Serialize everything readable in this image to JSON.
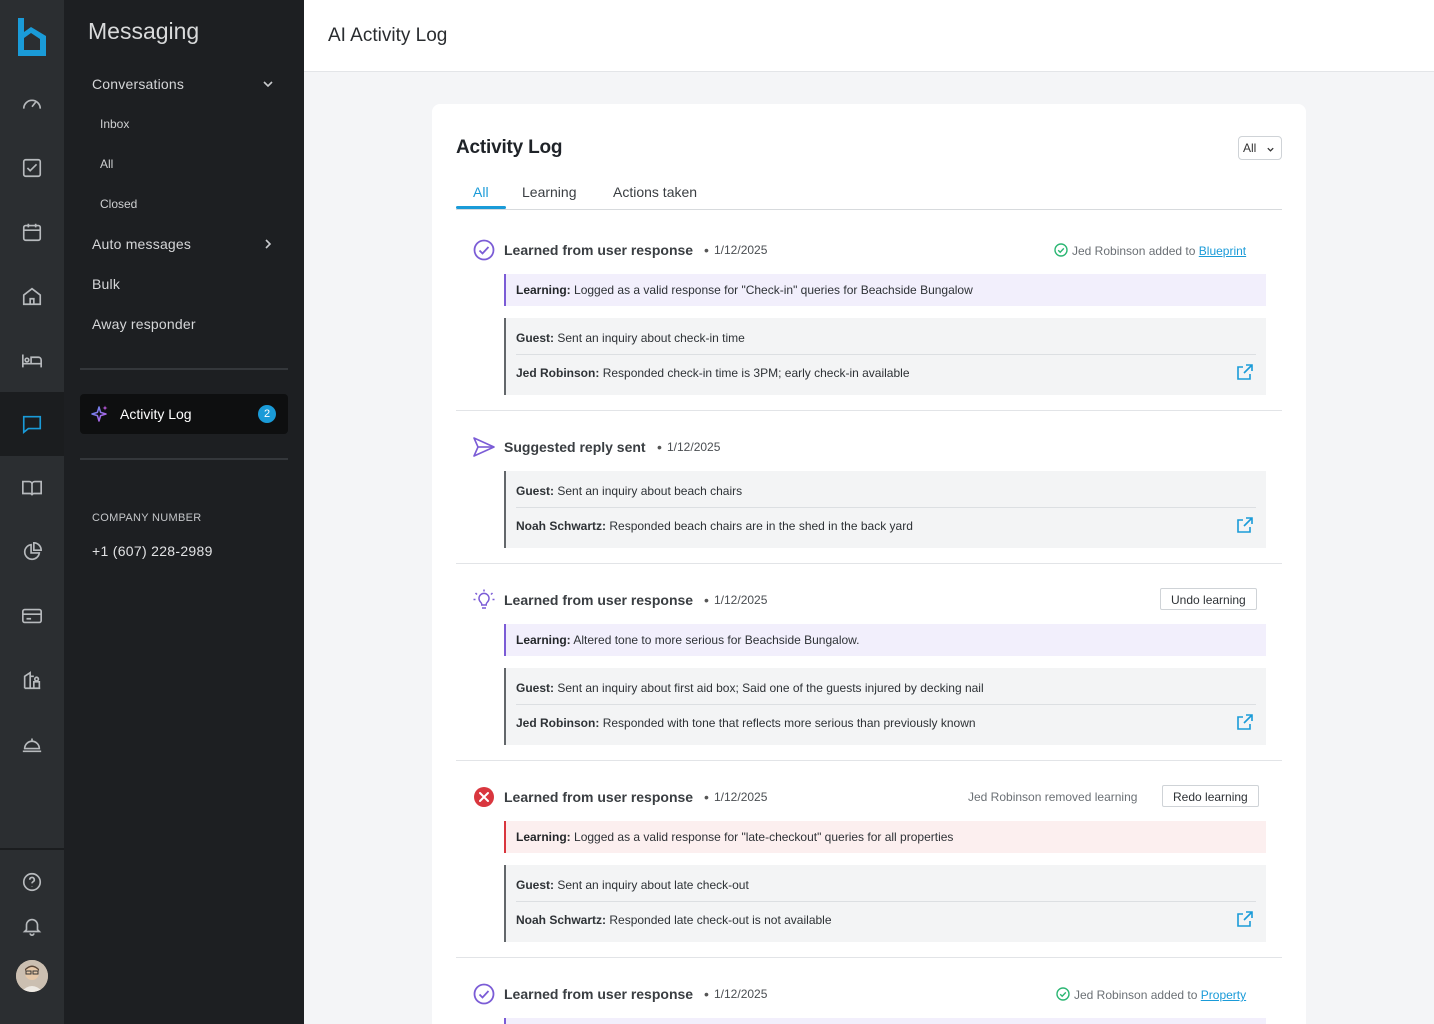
{
  "rail": {
    "items": [
      "dashboard-icon",
      "tasks-icon",
      "calendar-icon",
      "home-icon",
      "bed-icon",
      "messaging-icon",
      "guidebook-icon",
      "reports-icon",
      "billing-icon",
      "owners-icon",
      "concierge-icon"
    ],
    "bottom": [
      "help-icon",
      "notifications-icon",
      "avatar"
    ],
    "accent": "#1a9bd8"
  },
  "sidebar": {
    "title": "Messaging",
    "conversations": "Conversations",
    "inbox": "Inbox",
    "all": "All",
    "closed": "Closed",
    "auto_messages": "Auto messages",
    "bulk": "Bulk",
    "away_responder": "Away responder",
    "activity_log": "Activity Log",
    "activity_badge": "2",
    "company_label": "COMPANY NUMBER",
    "company_number": "+1 (607) 228-2989"
  },
  "header": {
    "title": "AI Activity Log"
  },
  "card": {
    "title": "Activity Log",
    "filter": "All",
    "tabs": [
      "All",
      "Learning",
      "Actions taken"
    ]
  },
  "entries": [
    {
      "title": "Learned from user response",
      "dot": "•",
      "date": "1/12/2025",
      "meta_text": "Jed Robinson added to",
      "meta_link": "Blueprint",
      "learning_label": "Learning:",
      "learning_text": "Logged as a valid response for \"Check-in\" queries for Beachside Bungalow",
      "guest_label": "Guest:",
      "guest_text": "Sent an inquiry about check-in time",
      "host_label": "Jed Robinson:",
      "host_text": "Responded check-in time is 3PM; early check-in available"
    },
    {
      "title": "Suggested reply sent",
      "dot": "•",
      "date": "1/12/2025",
      "guest_label": "Guest:",
      "guest_text": "Sent an inquiry about beach chairs",
      "host_label": "Noah Schwartz:",
      "host_text": "Responded beach chairs are in the shed in the back yard"
    },
    {
      "title": "Learned from user response",
      "dot": "•",
      "date": "1/12/2025",
      "button": "Undo learning",
      "learning_label": "Learning:",
      "learning_text": " Altered tone to more serious for Beachside Bungalow.",
      "guest_label": "Guest:",
      "guest_text": "Sent an inquiry about first aid box; Said one of the guests injured by decking nail",
      "host_label": "Jed Robinson:",
      "host_text": "Responded with tone that reflects more serious than previously known"
    },
    {
      "title": "Learned from user response",
      "dot": "•",
      "date": "1/12/2025",
      "meta_text": "Jed Robinson removed learning",
      "button": "Redo learning",
      "learning_label": "Learning:",
      "learning_text": "Logged as a valid response for \"late-checkout\" queries for all properties",
      "guest_label": "Guest:",
      "guest_text": "Sent an inquiry about late check-out",
      "host_label": "Noah Schwartz:",
      "host_text": "Responded late check-out is not available"
    },
    {
      "title": "Learned from user response",
      "dot": "•",
      "date": "1/12/2025",
      "meta_text": "Jed Robinson added to",
      "meta_link": "Property"
    }
  ],
  "colors": {
    "purple": "#7b5cd6",
    "error_red": "#d9363e",
    "success_green": "#2bb673",
    "link_blue": "#1a9bd8"
  }
}
